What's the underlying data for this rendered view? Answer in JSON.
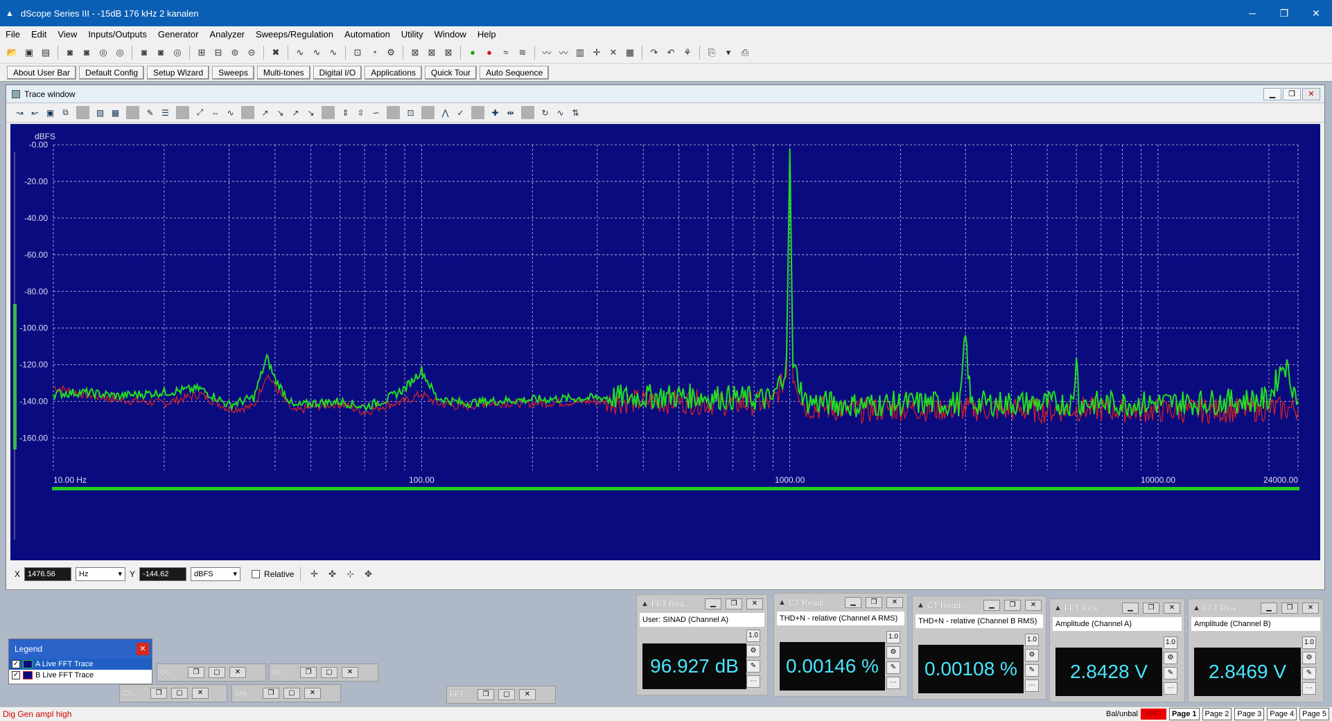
{
  "window": {
    "title": "dScope Series III - -15dB 176 kHz 2 kanalen",
    "minimize": "─",
    "restore": "❐",
    "close": "✕"
  },
  "menu": [
    "File",
    "Edit",
    "View",
    "Inputs/Outputs",
    "Generator",
    "Analyzer",
    "Sweeps/Regulation",
    "Automation",
    "Utility",
    "Window",
    "Help"
  ],
  "user_bar": [
    "About User Bar",
    "Default Config",
    "Setup Wizard",
    "Sweeps",
    "Multi-tones",
    "Digital I/O",
    "Applications",
    "Quick Tour",
    "Auto Sequence"
  ],
  "trace_window": {
    "title": "Trace window"
  },
  "cursor": {
    "x_label": "X",
    "x_value": "1476.56",
    "x_unit": "Hz",
    "y_label": "Y",
    "y_value": "-144.62",
    "y_unit": "dBFS",
    "relative_label": "Relative"
  },
  "chart_data": {
    "type": "line",
    "ylabel": "dBFS",
    "y_scale": "linear",
    "x_scale": "log",
    "xlim": [
      10,
      24000
    ],
    "ylim": [
      -170,
      0
    ],
    "y_ticks": [
      "-0.00",
      "-20.00",
      "-40.00",
      "-60.00",
      "-80.00",
      "-100.00",
      "-120.00",
      "-140.00",
      "-160.00"
    ],
    "x_ticks": [
      "10.00 Hz",
      "100.00",
      "1000.00",
      "10000.00",
      "24000.00"
    ],
    "series": [
      {
        "name": "A Live FFT Trace",
        "color": "#22dd22",
        "x": [
          10,
          12,
          15,
          20,
          25,
          30,
          35,
          38,
          40,
          45,
          50,
          60,
          70,
          80,
          90,
          100,
          110,
          130,
          150,
          200,
          300,
          500,
          700,
          900,
          980,
          1000,
          1020,
          1100,
          1500,
          2000,
          2500,
          2900,
          3000,
          3100,
          4000,
          5000,
          5900,
          6000,
          6100,
          10000,
          15000,
          20000,
          22000,
          24000
        ],
        "y": [
          -136,
          -135,
          -137,
          -135,
          -133,
          -142,
          -138,
          -116,
          -128,
          -143,
          -141,
          -140,
          -143,
          -139,
          -133,
          -123,
          -138,
          -141,
          -140,
          -139,
          -138,
          -137,
          -138,
          -139,
          -120,
          -2,
          -120,
          -140,
          -142,
          -141,
          -141,
          -141,
          -104,
          -141,
          -141,
          -141,
          -141,
          -112,
          -141,
          -141,
          -140,
          -139,
          -118,
          -140
        ]
      },
      {
        "name": "B Live FFT Trace",
        "color": "#dd2222",
        "x": [
          10,
          12,
          15,
          20,
          25,
          30,
          35,
          38,
          40,
          45,
          50,
          60,
          70,
          80,
          90,
          100,
          110,
          130,
          150,
          200,
          300,
          500,
          700,
          900,
          980,
          1000,
          1020,
          1100,
          1500,
          2000,
          3000,
          5000,
          6000,
          10000,
          15000,
          20000,
          24000
        ],
        "y": [
          -132,
          -136,
          -139,
          -141,
          -136,
          -144,
          -143,
          -125,
          -132,
          -146,
          -143,
          -141,
          -146,
          -142,
          -140,
          -136,
          -141,
          -143,
          -141,
          -141,
          -140,
          -140,
          -141,
          -141,
          -125,
          -3,
          -125,
          -143,
          -145,
          -144,
          -144,
          -145,
          -144,
          -145,
          -145,
          -144,
          -144
        ]
      }
    ]
  },
  "readouts": [
    {
      "title": "FFT Rea...",
      "label": "User: SINAD (Channel A)",
      "value": "96.927 dB"
    },
    {
      "title": "CT Readi...",
      "label": "THD+N - relative (Channel A RMS)",
      "value": "0.00146 %"
    },
    {
      "title": "CT Readi...",
      "label": "THD+N - relative (Channel B RMS)",
      "value": "0.00108 %"
    },
    {
      "title": "FFT Rea...",
      "label": "Amplitude (Channel A)",
      "value": "2.8428 V"
    },
    {
      "title": "FFT Rea...",
      "label": "Amplitude (Channel B)",
      "value": "2.8469 V"
    }
  ],
  "legend": {
    "title": "Legend",
    "items": [
      "A  Live FFT Trace",
      "B  Live FFT Trace"
    ]
  },
  "minimized": [
    "Ou...",
    "Ou...",
    "Co...",
    "Sig...",
    "FFT..."
  ],
  "status": {
    "message": "Dig Gen ampl high",
    "bal": "Bal/unbal",
    "bnc": "BNC",
    "pages": [
      "Page 1",
      "Page 2",
      "Page 3",
      "Page 4",
      "Page 5"
    ]
  }
}
